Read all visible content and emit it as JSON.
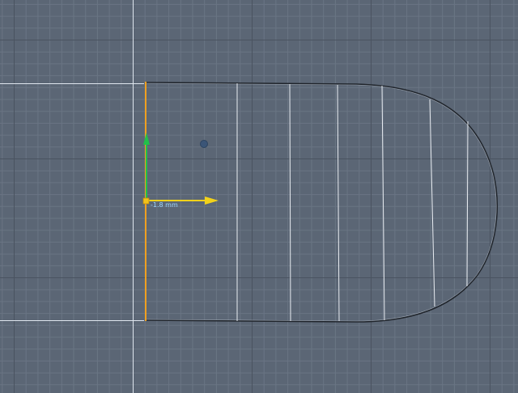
{
  "viewport": {
    "background_color": "#5b6675",
    "grid_minor_color": "#6a7584",
    "grid_major_color": "#4a5360",
    "axis_line_color": "#dfe6ee",
    "mesh_edge_color": "#e9edf2",
    "outline_color": "#1f242b",
    "selected_edge_color": "#f0a020",
    "pivot_color": "#3b5577"
  },
  "gizmo": {
    "y_axis_color": "#22c04a",
    "x_axis_color": "#f2d21a",
    "handle_color": "#f2c21a",
    "distance_readout": "-1.8 mm",
    "distance_color": "#9fd8ff"
  }
}
